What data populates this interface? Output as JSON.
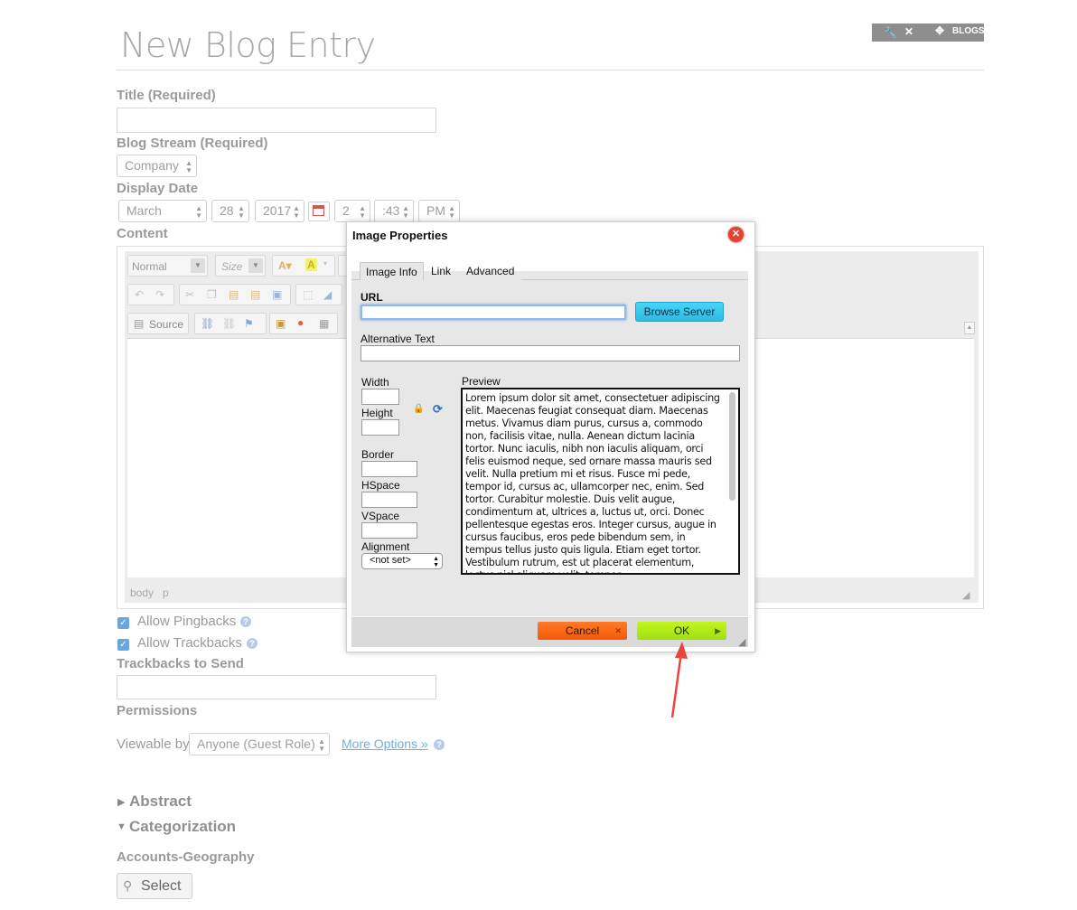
{
  "page": {
    "title": "New Blog Entry"
  },
  "top_toolbar": {
    "wrench_icon": "wrench-icon",
    "close_icon": "close-icon",
    "move_icon": "move-icon",
    "label": "BLOGS"
  },
  "form": {
    "title_label": "Title (Required)",
    "stream_label": "Blog Stream (Required)",
    "stream_value": "Company",
    "date_label": "Display Date",
    "date": {
      "month": "March",
      "day": "28",
      "year": "2017",
      "hour": "2",
      "minute": ":43",
      "ampm": "PM"
    },
    "content_label": "Content",
    "editor": {
      "format_value": "Normal",
      "size_value": "Size",
      "source_label": "Source",
      "path": [
        "body",
        "p"
      ]
    },
    "pingbacks_label": "Allow Pingbacks",
    "trackbacks_label": "Allow Trackbacks",
    "trackbacks_send_label": "Trackbacks to Send",
    "permissions_label": "Permissions",
    "viewable_label": "Viewable by",
    "viewable_value": "Anyone (Guest Role)",
    "more_options": "More Options »",
    "abstract_label": "Abstract",
    "categorization_label": "Categorization",
    "geography_label": "Accounts-Geography",
    "select_button": "Select"
  },
  "dialog": {
    "title": "Image Properties",
    "tabs": [
      "Image Info",
      "Link",
      "Advanced"
    ],
    "url_label": "URL",
    "url_value": "",
    "browse_button": "Browse Server",
    "alt_label": "Alternative Text",
    "width_label": "Width",
    "height_label": "Height",
    "border_label": "Border",
    "hspace_label": "HSpace",
    "vspace_label": "VSpace",
    "alignment_label": "Alignment",
    "alignment_value": "<not set>",
    "preview_label": "Preview",
    "preview_text": "Lorem ipsum dolor sit amet, consectetuer adipiscing elit. Maecenas feugiat consequat diam. Maecenas metus. Vivamus diam purus, cursus a, commodo non, facilisis vitae, nulla. Aenean dictum lacinia tortor. Nunc iaculis, nibh non iaculis aliquam, orci felis euismod neque, sed ornare massa mauris sed velit. Nulla pretium mi et risus. Fusce mi pede, tempor id, cursus ac, ullamcorper nec, enim. Sed tortor. Curabitur molestie. Duis velit augue, condimentum at, ultrices a, luctus ut, orci. Donec pellentesque egestas eros. Integer cursus, augue in cursus faucibus, eros pede bibendum sem, in tempus tellus justo quis ligula. Etiam eget tortor. Vestibulum rutrum, est ut placerat elementum, lectus nisl aliquam velit, tempor",
    "cancel_button": "Cancel",
    "ok_button": "OK"
  },
  "colors": {
    "arrow": "#e8453c",
    "ok": "#a8e816",
    "cancel": "#f7600e",
    "browse": "#33c4ea"
  }
}
